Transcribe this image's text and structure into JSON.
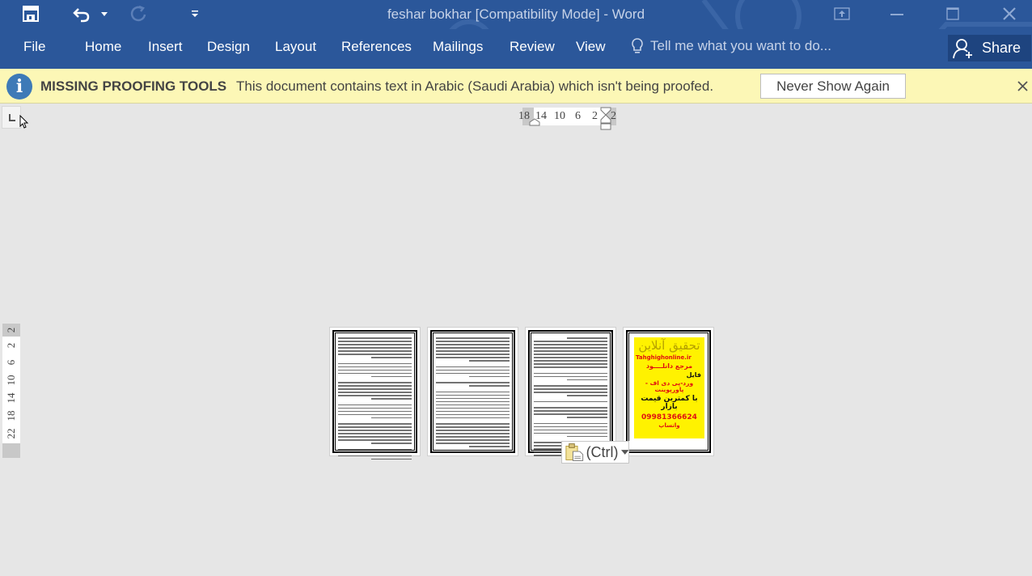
{
  "window": {
    "title": "feshar bokhar [Compatibility Mode] - Word"
  },
  "quick_access": {
    "save": "save-icon",
    "undo": "undo-icon",
    "redo": "redo-icon",
    "customize": "customize-qat-icon"
  },
  "ribbon": {
    "tabs": [
      {
        "label": "File"
      },
      {
        "label": "Home"
      },
      {
        "label": "Insert"
      },
      {
        "label": "Design"
      },
      {
        "label": "Layout"
      },
      {
        "label": "References"
      },
      {
        "label": "Mailings"
      },
      {
        "label": "Review"
      },
      {
        "label": "View"
      }
    ],
    "tell_me_placeholder": "Tell me what you want to do...",
    "share_label": "Share"
  },
  "message_bar": {
    "title": "MISSING PROOFING TOOLS",
    "text": "This document contains text in Arabic (Saudi Arabia) which isn't being proofed.",
    "button_label": "Never Show Again"
  },
  "horizontal_ruler": {
    "ticks": [
      "18",
      "14",
      "10",
      "6",
      "2",
      "2"
    ]
  },
  "vertical_ruler": {
    "ticks": [
      "2",
      "2",
      "6",
      "10",
      "14",
      "18",
      "22"
    ]
  },
  "pages": [
    {
      "index": 1,
      "kind": "text"
    },
    {
      "index": 2,
      "kind": "text"
    },
    {
      "index": 3,
      "kind": "text"
    },
    {
      "index": 4,
      "kind": "advertisement"
    }
  ],
  "advertisement": {
    "heading": "تحقیق آنلاین",
    "site": "Tahghighonline.ir",
    "line1": "مرجع دانلــــود",
    "line2": "فایل",
    "line3": "ورد-پی دی اف - پاورپوینت",
    "line4": "با کمترین قیمت بازار",
    "phone": "09981366624",
    "phone_suffix": "واتساپ",
    "colors": {
      "background": "#fff200",
      "heading": "#b5a000",
      "red": "#e01010",
      "black": "#111111"
    }
  },
  "paste_options": {
    "label": "(Ctrl)"
  },
  "colors": {
    "ribbon": "#2b579a",
    "share_bg": "#1e447f",
    "message_bar": "#fcf7b6",
    "info_icon": "#3e7ab7",
    "canvas": "#e6e6e6"
  }
}
